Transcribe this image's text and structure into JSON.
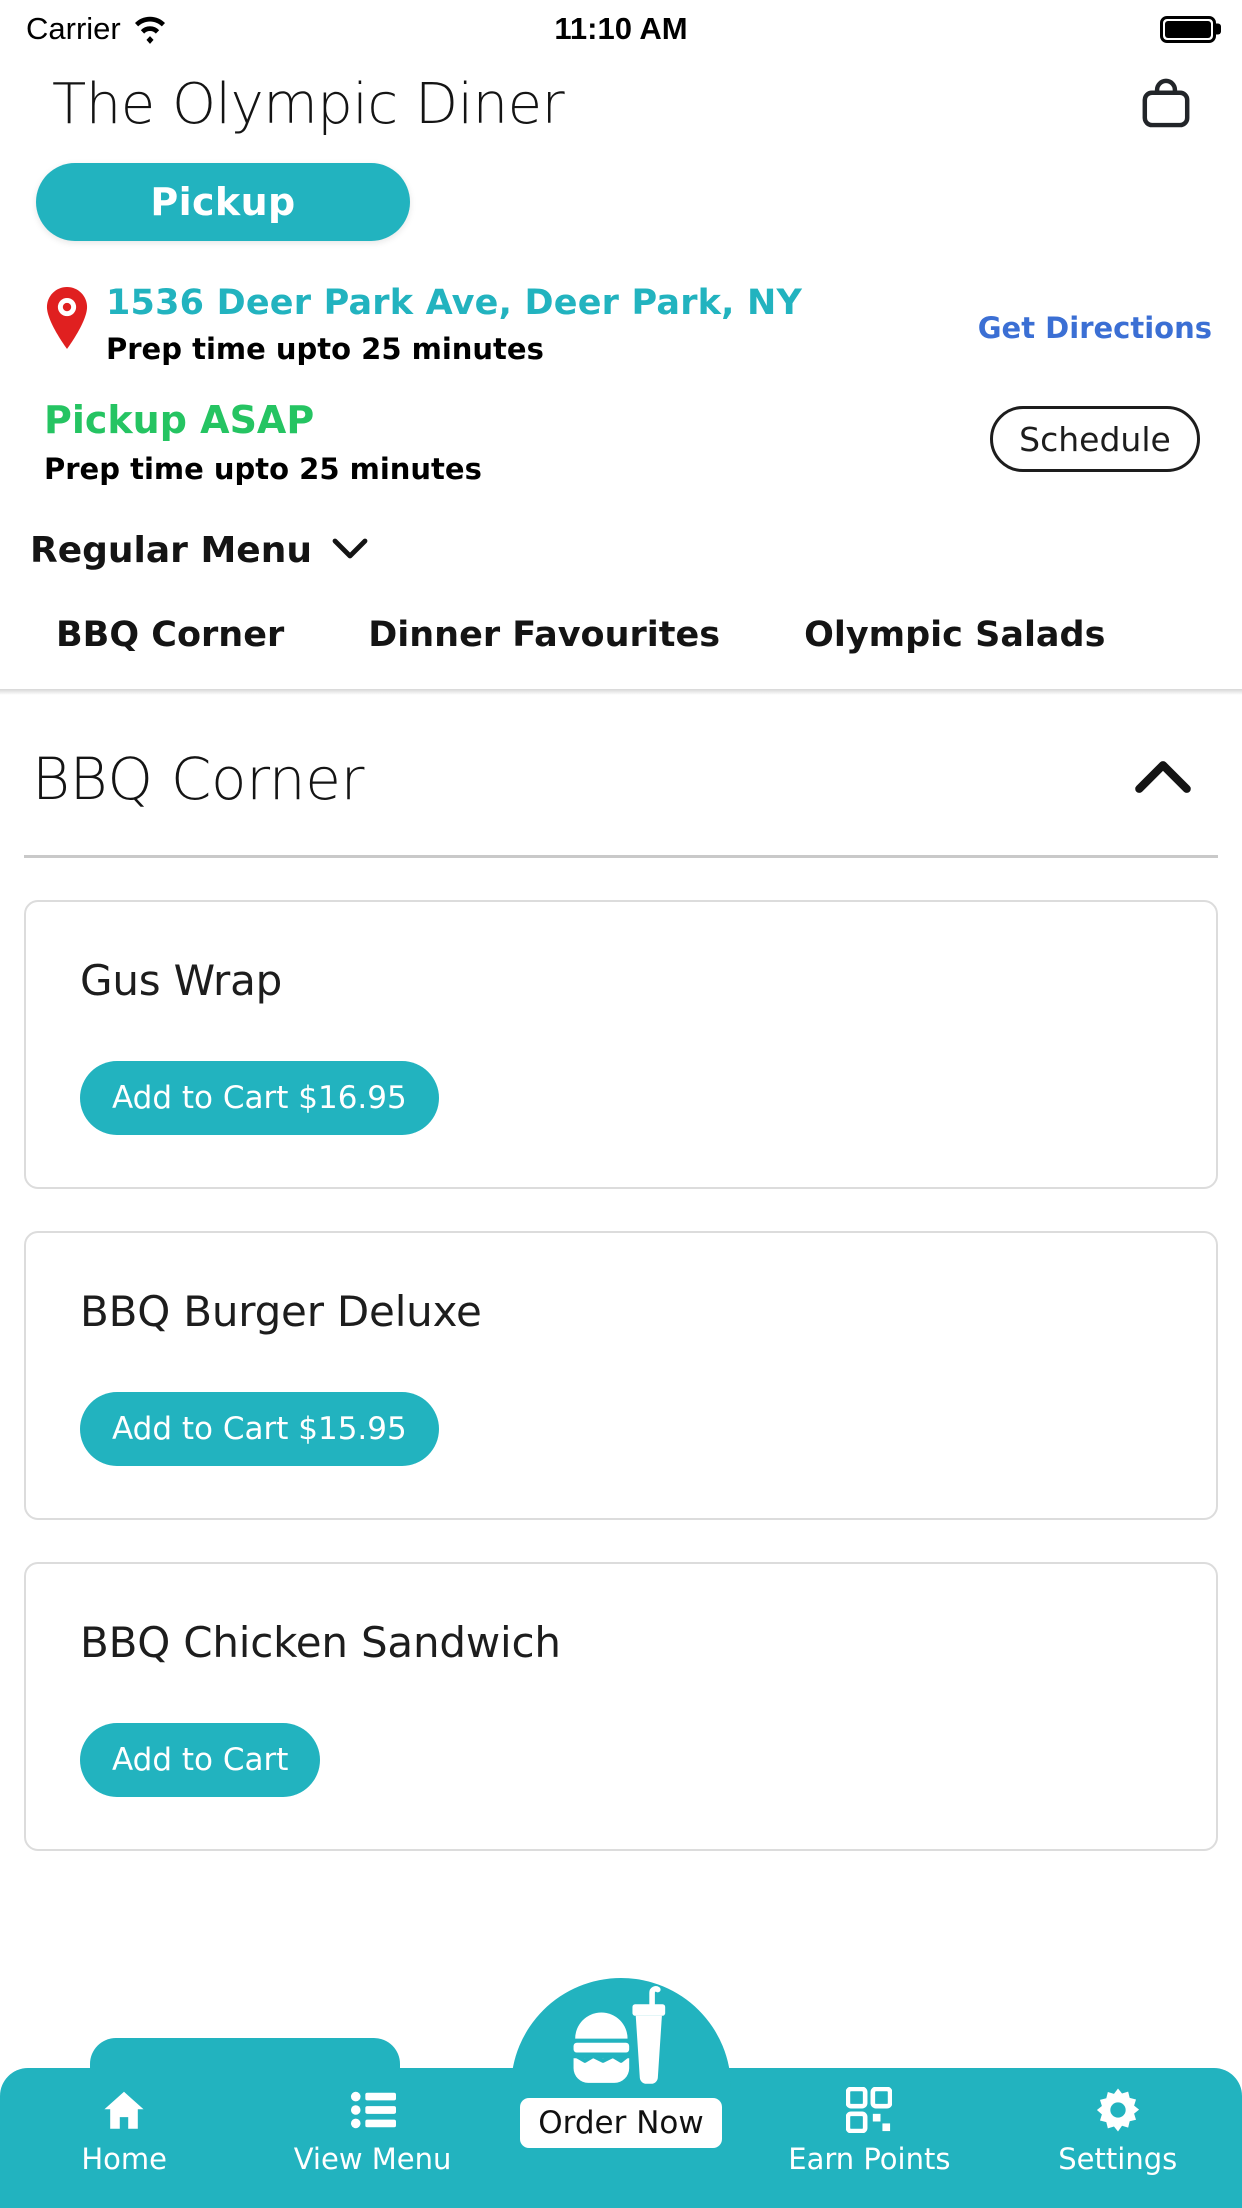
{
  "status_bar": {
    "carrier": "Carrier",
    "time": "11:10 AM",
    "wifi_icon": "wifi-icon",
    "battery_icon": "battery-full-icon"
  },
  "header": {
    "title": "The Olympic Diner",
    "cart_icon": "shopping-bag-icon"
  },
  "order_mode": {
    "selected_label": "Pickup"
  },
  "location": {
    "pin_icon": "map-pin-icon",
    "address": "1536 Deer Park Ave, Deer Park, NY",
    "prep_time": "Prep time upto 25 minutes",
    "directions_label": "Get Directions"
  },
  "timing": {
    "title": "Pickup ASAP",
    "prep_time": "Prep time upto 25 minutes",
    "schedule_label": "Schedule"
  },
  "menu_select": {
    "label": "Regular Menu",
    "chevron_icon": "chevron-down-icon"
  },
  "category_tabs": [
    {
      "label": "BBQ Corner"
    },
    {
      "label": "Dinner Favourites"
    },
    {
      "label": "Olympic Salads"
    }
  ],
  "section": {
    "title": "BBQ Corner",
    "collapse_icon": "chevron-up-icon"
  },
  "items": [
    {
      "name": "Gus Wrap",
      "add_label": "Add to Cart $16.95",
      "price": "$16.95"
    },
    {
      "name": "BBQ Burger Deluxe",
      "add_label": "Add to Cart $15.95",
      "price": "$15.95"
    },
    {
      "name": "BBQ Chicken Sandwich",
      "add_label": "Add to Cart",
      "price": ""
    }
  ],
  "bottom_nav": {
    "items": [
      {
        "label": "Home",
        "icon": "home-icon"
      },
      {
        "label": "View Menu",
        "icon": "list-icon"
      },
      {
        "label": "Earn Points",
        "icon": "qr-code-icon"
      },
      {
        "label": "Settings",
        "icon": "gear-icon"
      }
    ],
    "center": {
      "label": "Order Now",
      "icon": "burger-drink-icon"
    }
  },
  "colors": {
    "accent_teal": "#22b3bf",
    "asap_green": "#25c462",
    "link_blue": "#3b6fd4",
    "pin_red": "#e02020"
  }
}
